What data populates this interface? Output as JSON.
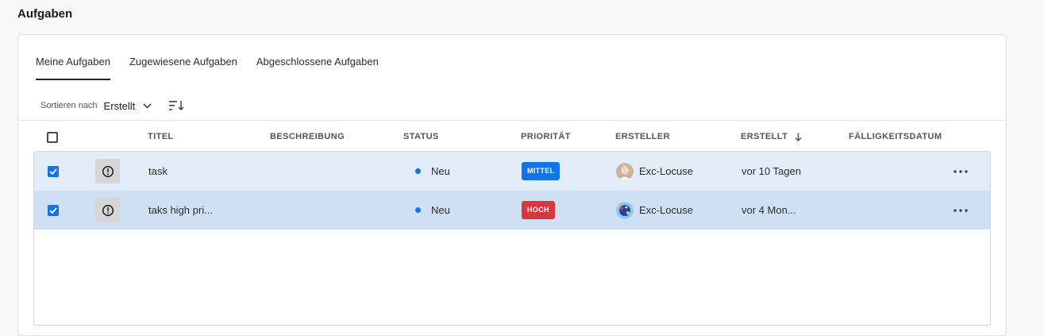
{
  "page": {
    "title": "Aufgaben"
  },
  "tabs": [
    {
      "label": "Meine Aufgaben",
      "active": true
    },
    {
      "label": "Zugewiesene Aufgaben",
      "active": false
    },
    {
      "label": "Abgeschlossene Aufgaben",
      "active": false
    }
  ],
  "sort": {
    "label": "Sortieren nach",
    "value": "Erstellt",
    "icons": {
      "dropdown": "chevron-down-icon",
      "order": "sort-order-icon"
    }
  },
  "table": {
    "columns": {
      "title": "TITEL",
      "description": "BESCHREIBUNG",
      "status": "STATUS",
      "priority": "PRIORITÄT",
      "creator": "ERSTELLER",
      "created": "ERSTELLT",
      "due": "FÄLLIGKEITSDATUM"
    },
    "sorted_column_icon": "arrow-down-icon",
    "rows": [
      {
        "selected": true,
        "type_icon": "alert-circle-icon",
        "title": "task",
        "description": "",
        "status": "Neu",
        "priority": "MITTEL",
        "priority_color": "#1473e6",
        "creator": "Exc-Locuse",
        "created": "vor 10 Tagen",
        "due": ""
      },
      {
        "selected": true,
        "type_icon": "alert-circle-icon",
        "title": "taks high pri...",
        "description": "",
        "status": "Neu",
        "priority": "HOCH",
        "priority_color": "#d7373f",
        "creator": "Exc-Locuse",
        "created": "vor 4 Mon...",
        "due": ""
      }
    ]
  },
  "colors": {
    "accent": "#1473e6",
    "row_selected": "#e3edf9",
    "row_selected_hover": "#cfe0f5",
    "status_new": "#1473e6"
  }
}
